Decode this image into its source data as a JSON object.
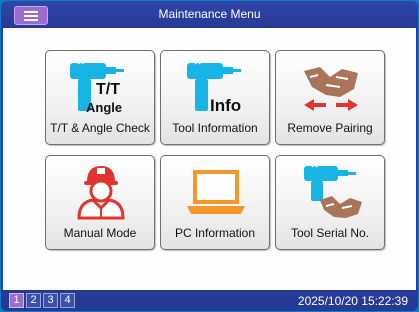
{
  "header": {
    "title": "Maintenance Menu",
    "menu_icon": "hamburger-icon"
  },
  "tiles": [
    {
      "label": "T/T & Angle Check",
      "icon": "torque-tool-angle-icon",
      "icon_text_1": "T/T",
      "icon_text_2": "Angle"
    },
    {
      "label": "Tool Information",
      "icon": "tool-info-icon",
      "icon_text_1": "Info"
    },
    {
      "label": "Remove Pairing",
      "icon": "handshake-arrows-icon"
    },
    {
      "label": "Manual Mode",
      "icon": "worker-icon"
    },
    {
      "label": "PC Information",
      "icon": "laptop-icon"
    },
    {
      "label": "Tool Serial No.",
      "icon": "tool-handshake-icon"
    }
  ],
  "footer": {
    "pages": [
      "1",
      "2",
      "3",
      "4"
    ],
    "active_page": "1",
    "datetime": "2025/10/20 15:22:39"
  },
  "colors": {
    "header_bg": "#263a95",
    "accent_purple": "#9a6bd1",
    "tool_cyan": "#16b5e6",
    "handshake_brown": "#a9745a",
    "worker_red": "#e0342f",
    "laptop_orange": "#f2992a"
  }
}
